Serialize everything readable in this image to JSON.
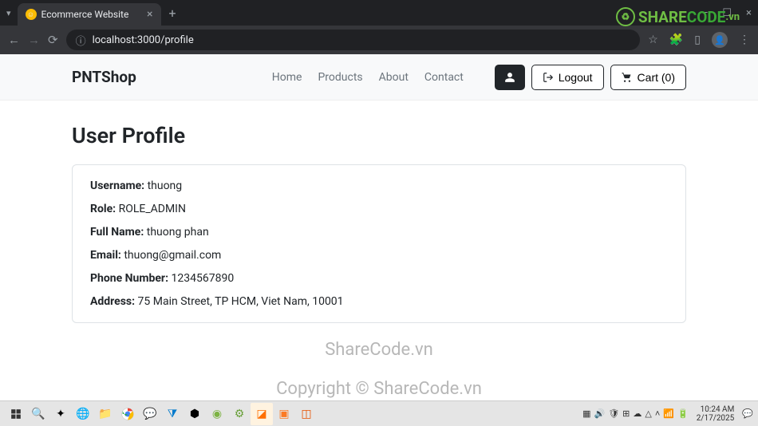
{
  "browser": {
    "tab_title": "Ecommerce Website",
    "url": "localhost:3000/profile"
  },
  "header": {
    "brand": "PNTShop",
    "nav": {
      "home": "Home",
      "products": "Products",
      "about": "About",
      "contact": "Contact"
    },
    "logout": "Logout",
    "cart": "Cart (0)"
  },
  "page": {
    "title": "User Profile",
    "labels": {
      "username": "Username:",
      "role": "Role:",
      "fullname": "Full Name:",
      "email": "Email:",
      "phone": "Phone Number:",
      "address": "Address:"
    },
    "values": {
      "username": "thuong",
      "role": "ROLE_ADMIN",
      "fullname": "thuong phan",
      "email": "thuong@gmail.com",
      "phone": "1234567890",
      "address": "75 Main Street, TP HCM, Viet Nam, 10001"
    }
  },
  "watermark": {
    "logo_text1": "SHARE",
    "logo_text2": "CODE",
    "logo_suffix": ".vn",
    "mid": "ShareCode.vn",
    "bottom": "Copyright © ShareCode.vn"
  },
  "taskbar": {
    "time": "10:24 AM",
    "date": "2/17/2025"
  }
}
